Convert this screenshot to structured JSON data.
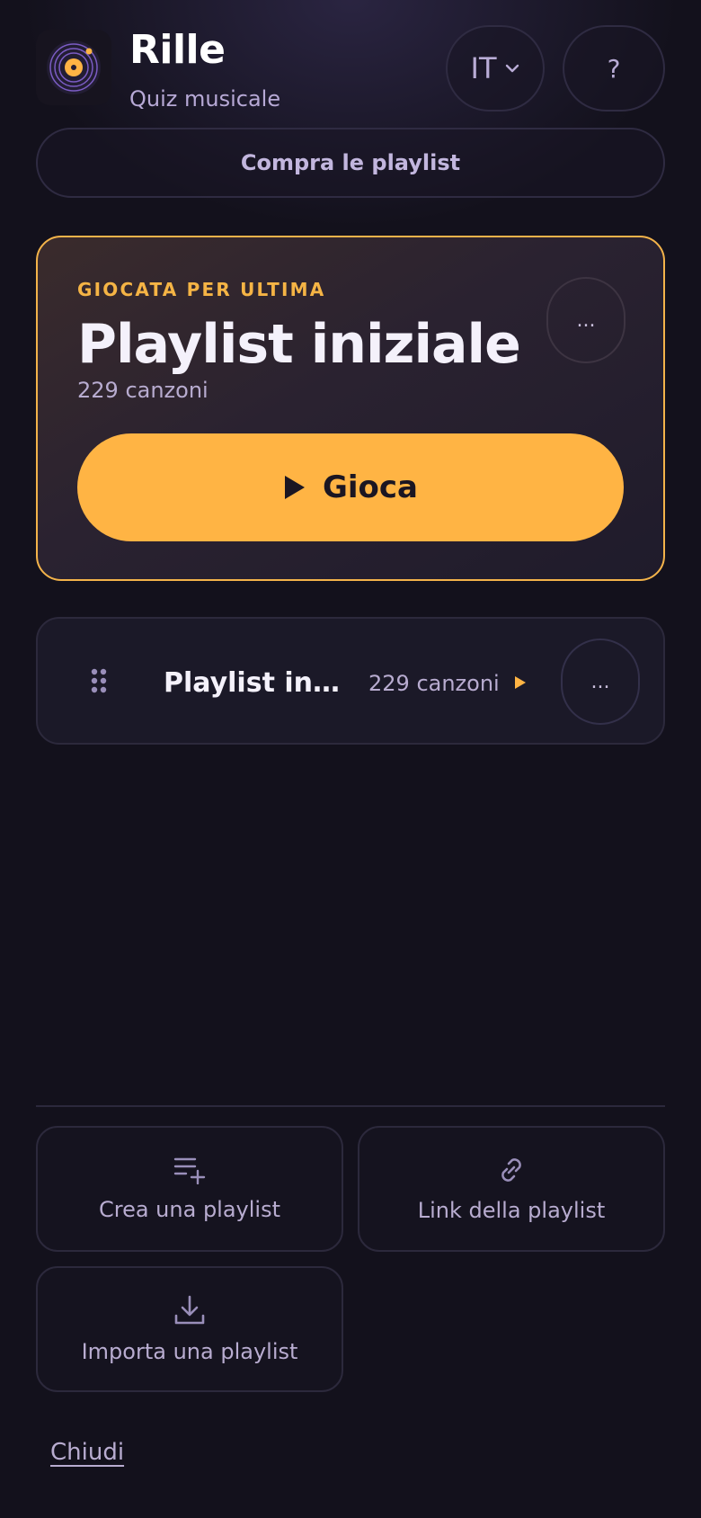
{
  "header": {
    "app_title": "Rille",
    "app_subtitle": "Quiz musicale",
    "language": "IT",
    "help_label": "?",
    "buy_label": "Compra le playlist"
  },
  "featured": {
    "eyebrow": "GIOCATA PER ULTIMA",
    "title": "Playlist iniziale",
    "count": "229 canzoni",
    "more_label": "...",
    "play_label": "Gioca"
  },
  "playlists": [
    {
      "title": "Playlist iniziale",
      "count": "229 canzoni",
      "more_label": "..."
    }
  ],
  "actions": {
    "create_label": "Crea una playlist",
    "link_label": "Link della playlist",
    "import_label": "Importa una playlist"
  },
  "footer": {
    "close_label": "Chiudi"
  },
  "colors": {
    "accent": "#ffb444",
    "background": "#13111c",
    "muted_text": "#b8acd0"
  },
  "icons": {
    "logo": "vinyl-record-icon",
    "language_chevron": "chevron-down-icon",
    "play": "play-icon",
    "drag": "drag-handle-icon",
    "create": "playlist-add-icon",
    "link": "link-icon",
    "import": "download-icon"
  }
}
